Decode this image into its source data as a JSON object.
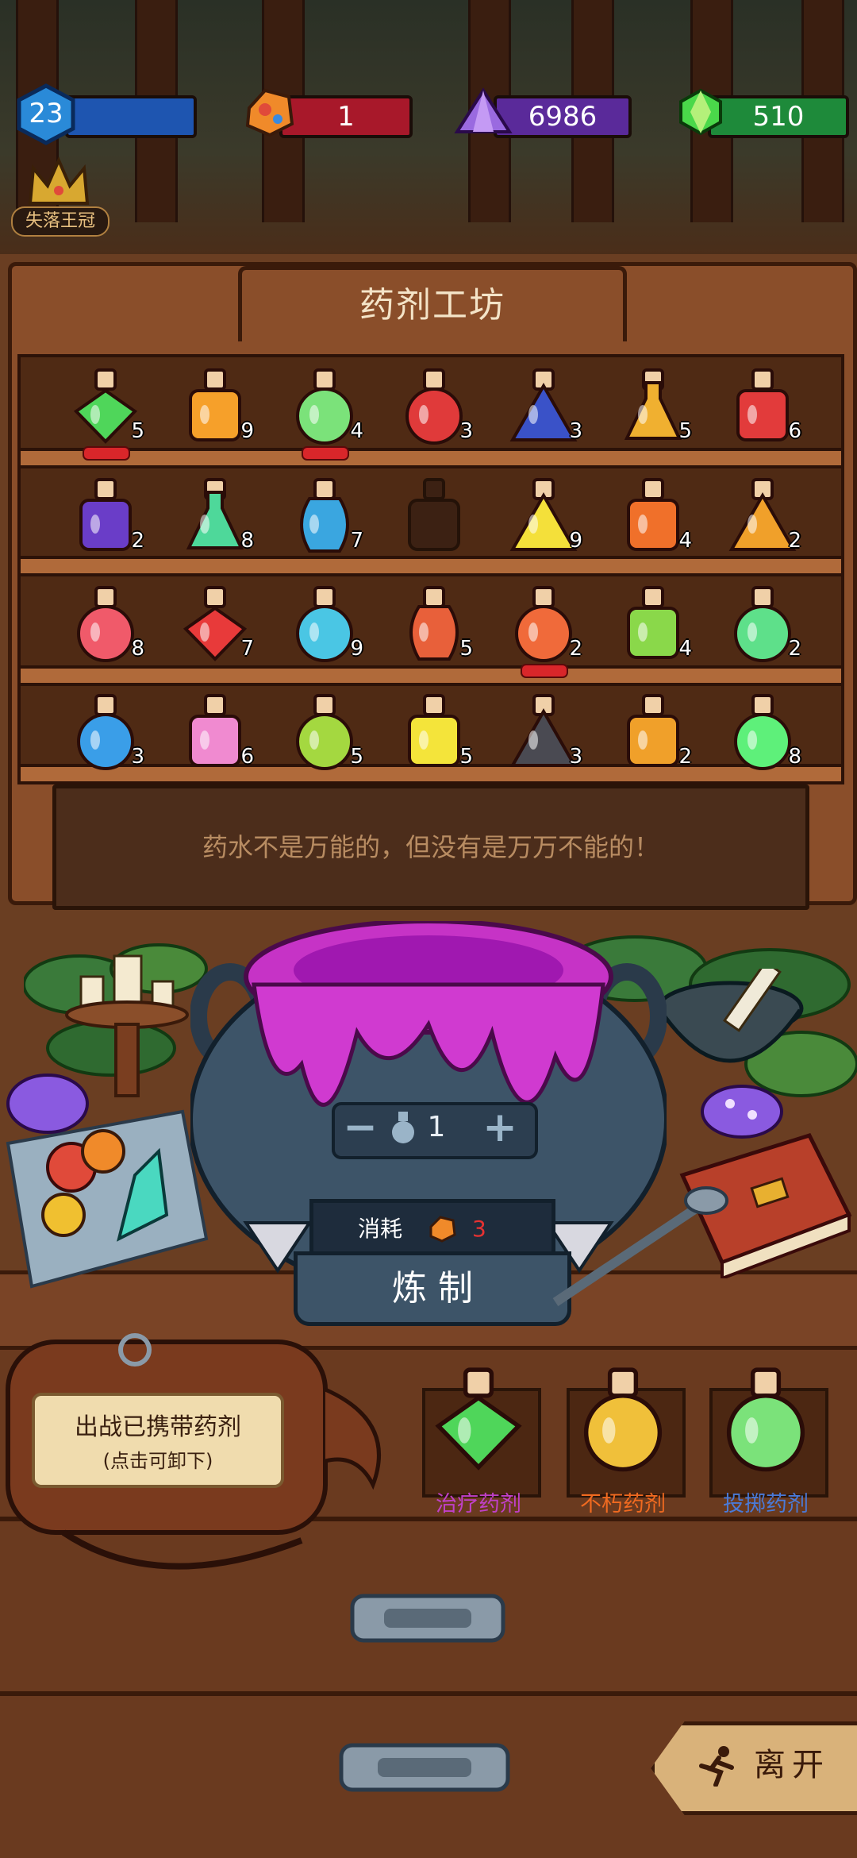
{
  "resources": {
    "level": "23",
    "ore": "1",
    "crystal": "6986",
    "gem": "510"
  },
  "crown": {
    "label": "失落王冠"
  },
  "workshop": {
    "title": "药剂工坊"
  },
  "shelves": [
    [
      {
        "count": "5",
        "color": "#4fd65a",
        "shape": "diamond"
      },
      {
        "count": "9",
        "color": "#f6a02a",
        "shape": "jar"
      },
      {
        "count": "4",
        "color": "#7be27a",
        "shape": "round"
      },
      {
        "count": "3",
        "color": "#e03a3a",
        "shape": "round"
      },
      {
        "count": "3",
        "color": "#3a52c8",
        "shape": "cone"
      },
      {
        "count": "5",
        "color": "#f0b030",
        "shape": "flask"
      },
      {
        "count": "6",
        "color": "#e23b3b",
        "shape": "jar"
      }
    ],
    [
      {
        "count": "2",
        "color": "#6a3dc8",
        "shape": "jar"
      },
      {
        "count": "8",
        "color": "#4ed89a",
        "shape": "flask"
      },
      {
        "count": "7",
        "color": "#3aa6e0",
        "shape": "vase"
      },
      {
        "count": "",
        "color": "#3c2113",
        "shape": "jar"
      },
      {
        "count": "9",
        "color": "#f4e03a",
        "shape": "cone"
      },
      {
        "count": "4",
        "color": "#f0702a",
        "shape": "jar"
      },
      {
        "count": "2",
        "color": "#f0a02a",
        "shape": "cone"
      }
    ],
    [
      {
        "count": "8",
        "color": "#f05a6a",
        "shape": "round"
      },
      {
        "count": "7",
        "color": "#e83a3a",
        "shape": "diamond"
      },
      {
        "count": "9",
        "color": "#4ac6e4",
        "shape": "round"
      },
      {
        "count": "5",
        "color": "#e8603a",
        "shape": "vase"
      },
      {
        "count": "2",
        "color": "#f06a3a",
        "shape": "round"
      },
      {
        "count": "4",
        "color": "#8ad84a",
        "shape": "jar"
      },
      {
        "count": "2",
        "color": "#5ee08a",
        "shape": "round"
      }
    ],
    [
      {
        "count": "3",
        "color": "#3a9ee8",
        "shape": "round"
      },
      {
        "count": "6",
        "color": "#f08ad0",
        "shape": "jar"
      },
      {
        "count": "5",
        "color": "#a4d840",
        "shape": "round"
      },
      {
        "count": "5",
        "color": "#f4e43a",
        "shape": "jar"
      },
      {
        "count": "3",
        "color": "#4a4a52",
        "shape": "cone"
      },
      {
        "count": "2",
        "color": "#f0a02a",
        "shape": "jar"
      },
      {
        "count": "8",
        "color": "#5ef07a",
        "shape": "round"
      }
    ]
  ],
  "message": "药水不是万能的，但没有是万万不能的！",
  "cauldron": {
    "quantity": "1",
    "minus": "−",
    "plus": "+",
    "cost_label": "消耗",
    "cost_value": "3",
    "brew_label": "炼 制"
  },
  "bag": {
    "title": "出战已携带药剂",
    "subtitle": "(点击可卸下)"
  },
  "equipped": [
    {
      "name": "治疗药剂",
      "color": "#c040c8",
      "bottle": "#4fd65a"
    },
    {
      "name": "不朽药剂",
      "color": "#f06a20",
      "bottle": "#f0c03a"
    },
    {
      "name": "投掷药剂",
      "color": "#4a7ad8",
      "bottle": "#7be27a"
    }
  ],
  "leave": {
    "label": "离开"
  }
}
